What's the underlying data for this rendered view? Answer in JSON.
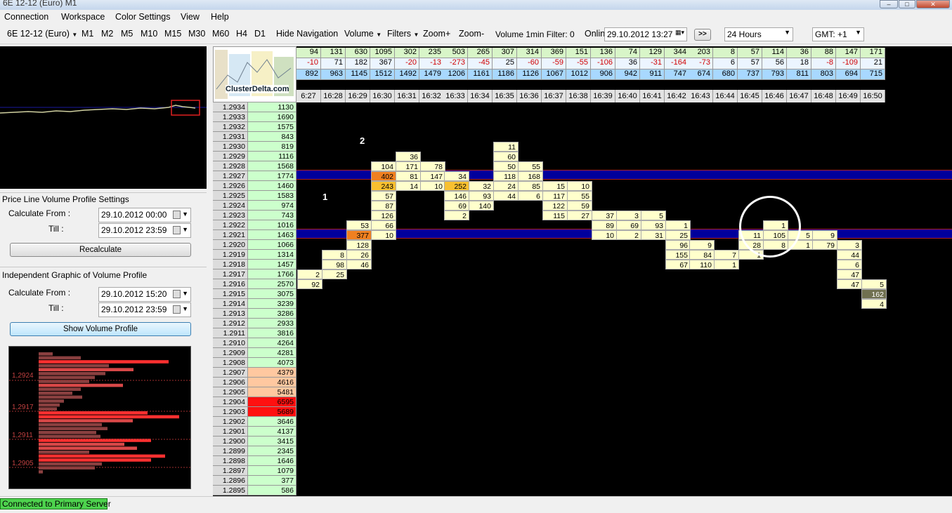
{
  "window": {
    "title": "6E 12-12 (Euro) M1"
  },
  "menu": [
    "Connection",
    "Workspace",
    "Color Settings",
    "View",
    "Help"
  ],
  "toolbar": {
    "instrument": "6E 12-12 (Euro)",
    "timeframes": [
      "M1",
      "M2",
      "M5",
      "M10",
      "M15",
      "M30",
      "M60",
      "H4",
      "D1"
    ],
    "hide_nav": "Hide Navigation",
    "volume": "Volume",
    "filters": "Filters",
    "zoom_in": "Zoom+",
    "zoom_out": "Zoom-",
    "volume_filter": "Volume 1min Filter: 0",
    "online": "Onlin",
    "datetime": "29.10.2012 13:27",
    "go": ">>",
    "range": "24 Hours",
    "gmt": "GMT: +1"
  },
  "left": {
    "pl_title": "Price Line Volume Profile Settings",
    "calc_from": "Calculate From :",
    "till": "Till :",
    "pl_from": "29.10.2012 00:00",
    "pl_till": "29.10.2012 23:59",
    "recalc": "Recalculate",
    "ig_title": "Independent Graphic of Volume Profile",
    "ig_from": "29.10.2012 15:20",
    "ig_till": "29.10.2012 23:59",
    "show": "Show Volume Profile",
    "vp_levels": [
      "1,2924",
      "1,2917",
      "1,2911",
      "1,2905"
    ]
  },
  "status": "Connected to Primary Server",
  "logo": "ClusterDelta.com",
  "annotations": [
    "1",
    "2"
  ],
  "header": {
    "row1": [
      "94",
      "131",
      "630",
      "1095",
      "302",
      "235",
      "503",
      "265",
      "307",
      "314",
      "369",
      "151",
      "136",
      "74",
      "129",
      "344",
      "203",
      "8",
      "57",
      "114",
      "36",
      "88",
      "147",
      "171"
    ],
    "row2": [
      "-10",
      "71",
      "182",
      "367",
      "-20",
      "-13",
      "-273",
      "-45",
      "25",
      "-60",
      "-59",
      "-55",
      "-106",
      "36",
      "-31",
      "-164",
      "-73",
      "6",
      "57",
      "56",
      "18",
      "-8",
      "-109",
      "21"
    ],
    "row3": [
      "892",
      "963",
      "1145",
      "1512",
      "1492",
      "1479",
      "1206",
      "1161",
      "1186",
      "1126",
      "1067",
      "1012",
      "906",
      "942",
      "911",
      "747",
      "674",
      "680",
      "737",
      "793",
      "811",
      "803",
      "694",
      "715"
    ],
    "times": [
      "6:27",
      "16:28",
      "16:29",
      "16:30",
      "16:31",
      "16:32",
      "16:33",
      "16:34",
      "16:35",
      "16:36",
      "16:37",
      "16:38",
      "16:39",
      "16:40",
      "16:41",
      "16:42",
      "16:43",
      "16:44",
      "16:45",
      "16:46",
      "16:47",
      "16:48",
      "16:49",
      "16:50"
    ]
  },
  "prices": [
    "1.2934",
    "1.2933",
    "1.2932",
    "1.2931",
    "1.2930",
    "1.2929",
    "1.2928",
    "1.2927",
    "1.2926",
    "1.2925",
    "1.2924",
    "1.2923",
    "1.2922",
    "1.2921",
    "1.2920",
    "1.2919",
    "1.2918",
    "1.2917",
    "1.2916",
    "1.2915",
    "1.2914",
    "1.2913",
    "1.2912",
    "1.2911",
    "1.2910",
    "1.2909",
    "1.2908",
    "1.2907",
    "1.2906",
    "1.2905",
    "1.2904",
    "1.2903",
    "1.2902",
    "1.2901",
    "1.2900",
    "1.2899",
    "1.2898",
    "1.2897",
    "1.2896",
    "1.2895"
  ],
  "volumes": [
    "1130",
    "1690",
    "1575",
    "843",
    "819",
    "1116",
    "1568",
    "1774",
    "1460",
    "1583",
    "974",
    "743",
    "1016",
    "1463",
    "1066",
    "1314",
    "1457",
    "1766",
    "2570",
    "3075",
    "3239",
    "3286",
    "2933",
    "3816",
    "4264",
    "4281",
    "4073",
    "4379",
    "4616",
    "5481",
    "6595",
    "5689",
    "3646",
    "4137",
    "3415",
    "2345",
    "1646",
    "1079",
    "377",
    "586"
  ],
  "cells": [
    [
      0,
      17,
      "2"
    ],
    [
      0,
      18,
      "92"
    ],
    [
      1,
      15,
      "8"
    ],
    [
      1,
      16,
      "98"
    ],
    [
      1,
      17,
      "25"
    ],
    [
      2,
      12,
      "53"
    ],
    [
      2,
      13,
      "377"
    ],
    [
      2,
      14,
      "128"
    ],
    [
      2,
      15,
      "26"
    ],
    [
      2,
      16,
      "46"
    ],
    [
      3,
      6,
      "104"
    ],
    [
      3,
      7,
      "402"
    ],
    [
      3,
      8,
      "243"
    ],
    [
      3,
      9,
      "57"
    ],
    [
      3,
      10,
      "87"
    ],
    [
      3,
      11,
      "126"
    ],
    [
      3,
      12,
      "66"
    ],
    [
      3,
      13,
      "10"
    ],
    [
      4,
      5,
      "36"
    ],
    [
      4,
      6,
      "171"
    ],
    [
      4,
      7,
      "81"
    ],
    [
      4,
      8,
      "14"
    ],
    [
      5,
      6,
      "78"
    ],
    [
      5,
      7,
      "147"
    ],
    [
      5,
      8,
      "10"
    ],
    [
      6,
      7,
      "34"
    ],
    [
      6,
      8,
      "252"
    ],
    [
      6,
      9,
      "146"
    ],
    [
      6,
      10,
      "69"
    ],
    [
      6,
      11,
      "2"
    ],
    [
      7,
      8,
      "32"
    ],
    [
      7,
      9,
      "93"
    ],
    [
      7,
      10,
      "140"
    ],
    [
      8,
      4,
      "11"
    ],
    [
      8,
      5,
      "60"
    ],
    [
      8,
      6,
      "50"
    ],
    [
      8,
      7,
      "118"
    ],
    [
      8,
      8,
      "24"
    ],
    [
      8,
      9,
      "44"
    ],
    [
      9,
      6,
      "55"
    ],
    [
      9,
      7,
      "168"
    ],
    [
      9,
      8,
      "85"
    ],
    [
      9,
      9,
      "6"
    ],
    [
      10,
      8,
      "15"
    ],
    [
      10,
      9,
      "117"
    ],
    [
      10,
      10,
      "122"
    ],
    [
      10,
      11,
      "115"
    ],
    [
      11,
      8,
      "10"
    ],
    [
      11,
      9,
      "55"
    ],
    [
      11,
      10,
      "59"
    ],
    [
      11,
      11,
      "27"
    ],
    [
      12,
      11,
      "37"
    ],
    [
      12,
      12,
      "89"
    ],
    [
      12,
      13,
      "10"
    ],
    [
      13,
      11,
      "3"
    ],
    [
      13,
      12,
      "69"
    ],
    [
      13,
      13,
      "2"
    ],
    [
      14,
      11,
      "5"
    ],
    [
      14,
      12,
      "93"
    ],
    [
      14,
      13,
      "31"
    ],
    [
      15,
      12,
      "1"
    ],
    [
      15,
      13,
      "25"
    ],
    [
      15,
      14,
      "96"
    ],
    [
      15,
      15,
      "155"
    ],
    [
      15,
      16,
      "67"
    ],
    [
      16,
      14,
      "9"
    ],
    [
      16,
      15,
      "84"
    ],
    [
      16,
      16,
      "110"
    ],
    [
      17,
      15,
      "7"
    ],
    [
      17,
      16,
      "1"
    ],
    [
      18,
      13,
      "11"
    ],
    [
      18,
      14,
      "28"
    ],
    [
      18,
      15,
      "1"
    ],
    [
      19,
      12,
      "1"
    ],
    [
      19,
      13,
      "105"
    ],
    [
      19,
      14,
      "8"
    ],
    [
      20,
      13,
      "5"
    ],
    [
      20,
      14,
      "1"
    ],
    [
      21,
      13,
      "9"
    ],
    [
      21,
      14,
      "79"
    ],
    [
      22,
      14,
      "3"
    ],
    [
      22,
      15,
      "44"
    ],
    [
      22,
      16,
      "6"
    ],
    [
      22,
      17,
      "47"
    ],
    [
      22,
      18,
      "47"
    ],
    [
      23,
      18,
      "5"
    ],
    [
      23,
      19,
      "162"
    ],
    [
      23,
      20,
      "4"
    ]
  ]
}
